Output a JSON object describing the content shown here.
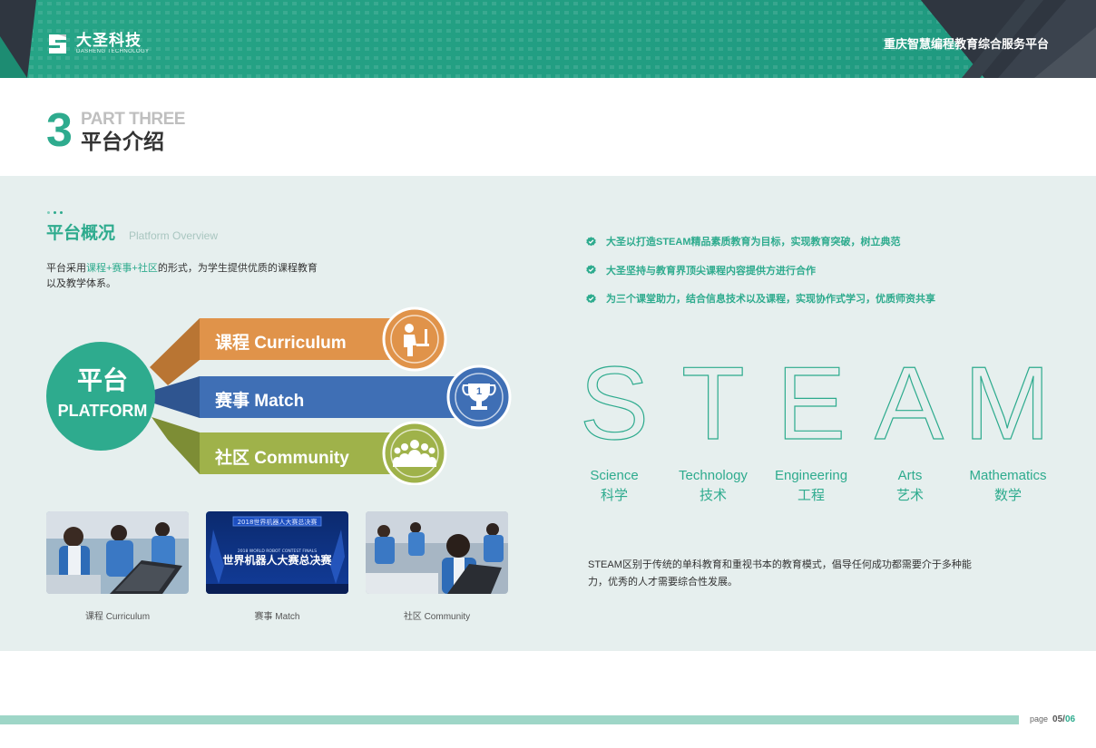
{
  "header": {
    "logo_cn": "大圣科技",
    "logo_en": "DASHENG TECHNOLOGY",
    "title": "重庆智慧编程教育综合服务平台"
  },
  "section": {
    "number": "3",
    "part": "PART THREE",
    "title_cn": "平台介绍"
  },
  "overview": {
    "title": "平台概况",
    "subtitle": "Platform Overview",
    "desc_pre": "平台采用",
    "desc_highlight": "课程+赛事+社区",
    "desc_post": "的形式，为学生提供优质的课程教育以及教学体系。"
  },
  "diagram": {
    "hub_cn": "平台",
    "hub_en": "PLATFORM",
    "ribbons": [
      {
        "label": "课程 Curriculum",
        "color": "#e0934a",
        "icon": "teacher-icon"
      },
      {
        "label": "赛事 Match",
        "color": "#3f6fb5",
        "icon": "trophy-icon"
      },
      {
        "label": "社区 Community",
        "color": "#9fb24a",
        "icon": "community-icon"
      }
    ]
  },
  "photos": [
    {
      "caption": "课程   Curriculum",
      "scene": "students-laptops"
    },
    {
      "caption": "赛事   Match",
      "scene": "robot-competition-stage",
      "stage_top": "2018世界机器人大赛总决赛",
      "stage_sub": "2018 WORLD ROBOT CONTEST FINALS",
      "stage_main": "世界机器人大赛总决赛"
    },
    {
      "caption": "社区   Community",
      "scene": "student-at-laptop"
    }
  ],
  "bullets": [
    "大圣以打造STEAM精品素质教育为目标，实现教育突破，树立典范",
    "大圣坚持与教育界顶尖课程内容提供方进行合作",
    "为三个课堂助力，结合信息技术以及课程，实现协作式学习，优质师资共享"
  ],
  "steam": {
    "letters": [
      "S",
      "T",
      "E",
      "A",
      "M"
    ],
    "items": [
      {
        "en": "Science",
        "cn": "科学"
      },
      {
        "en": "Technology",
        "cn": "技术"
      },
      {
        "en": "Engineering",
        "cn": "工程"
      },
      {
        "en": "Arts",
        "cn": "艺术"
      },
      {
        "en": "Mathematics",
        "cn": "数学"
      }
    ],
    "desc": "STEAM区别于传统的单科教育和重视书本的教育模式，倡导任何成功都需要介于多种能力，优秀的人才需要综合性发展。"
  },
  "footer": {
    "page_label": "page",
    "current": "05",
    "separator": "/",
    "total": "06"
  },
  "colors": {
    "teal": "#2eab8e",
    "panel": "#e6efee",
    "dark": "#2f3640"
  }
}
